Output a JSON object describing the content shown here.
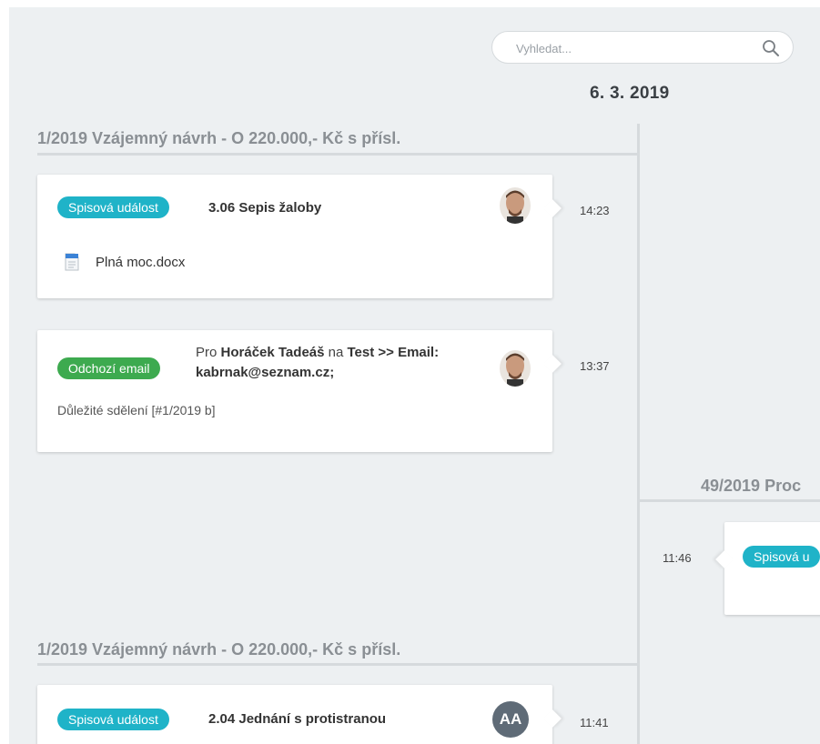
{
  "search": {
    "placeholder": "Vyhledat..."
  },
  "date_heading": "6. 3. 2019",
  "groups": [
    {
      "title": "1/2019 Vzájemný návrh - O 220.000,- Kč s přísl."
    },
    {
      "title": "49/2019 Proc"
    },
    {
      "title": "1/2019 Vzájemný návrh - O 220.000,- Kč s přísl."
    }
  ],
  "events": [
    {
      "badge": "Spisová událost",
      "title": "3.06 Sepis žaloby",
      "attachment": "Plná moc.docx",
      "time": "14:23",
      "avatar": "user-photo"
    },
    {
      "badge": "Odchozí email",
      "line1_prefix": "Pro ",
      "recipient": "Horáček Tadeáš",
      "line1_mid": " na ",
      "target": "Test >> Email:",
      "line2": "kabrnak@seznam.cz;",
      "subject": "Důležité sdělení [#1/2019 b]",
      "time": "13:37",
      "avatar": "user-photo"
    },
    {
      "badge": "Spisová u",
      "time": "11:46"
    },
    {
      "badge": "Spisová událost",
      "title": "2.04 Jednání s protistranou",
      "time": "11:41",
      "avatar_initials": "AA"
    }
  ],
  "colors": {
    "teal_badge": "#1fb3c8",
    "green_badge": "#3daa4f",
    "background": "#edf0f2"
  }
}
